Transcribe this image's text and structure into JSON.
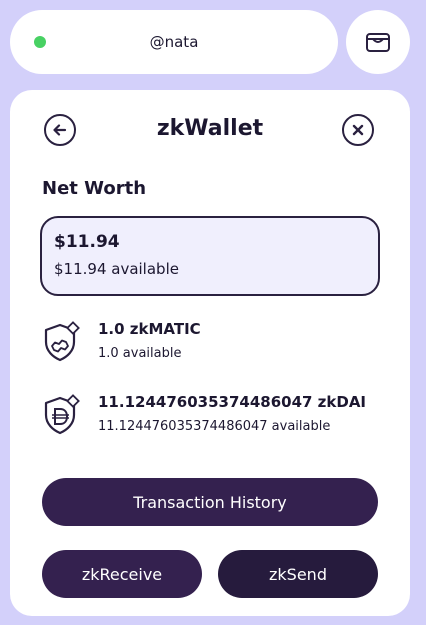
{
  "header": {
    "username": "@nata",
    "status_color": "#48d163"
  },
  "wallet": {
    "title": "zkWallet",
    "net_worth_label": "Net Worth",
    "net_worth_amount": "$11.94",
    "net_worth_available": "$11.94 available"
  },
  "tokens": [
    {
      "name": "1.0 zkMATIC",
      "available": "1.0 available",
      "icon": "matic-shield-icon"
    },
    {
      "name": "11.124476035374486047 zkDAI",
      "available": "11.124476035374486047 available",
      "icon": "dai-shield-icon"
    }
  ],
  "actions": {
    "history_label": "Transaction History",
    "receive_label": "zkReceive",
    "send_label": "zkSend"
  },
  "colors": {
    "background": "#d3d0fa",
    "primary_button": "#34214f",
    "send_button": "#261b3d",
    "networth_bg": "#f0effd"
  }
}
